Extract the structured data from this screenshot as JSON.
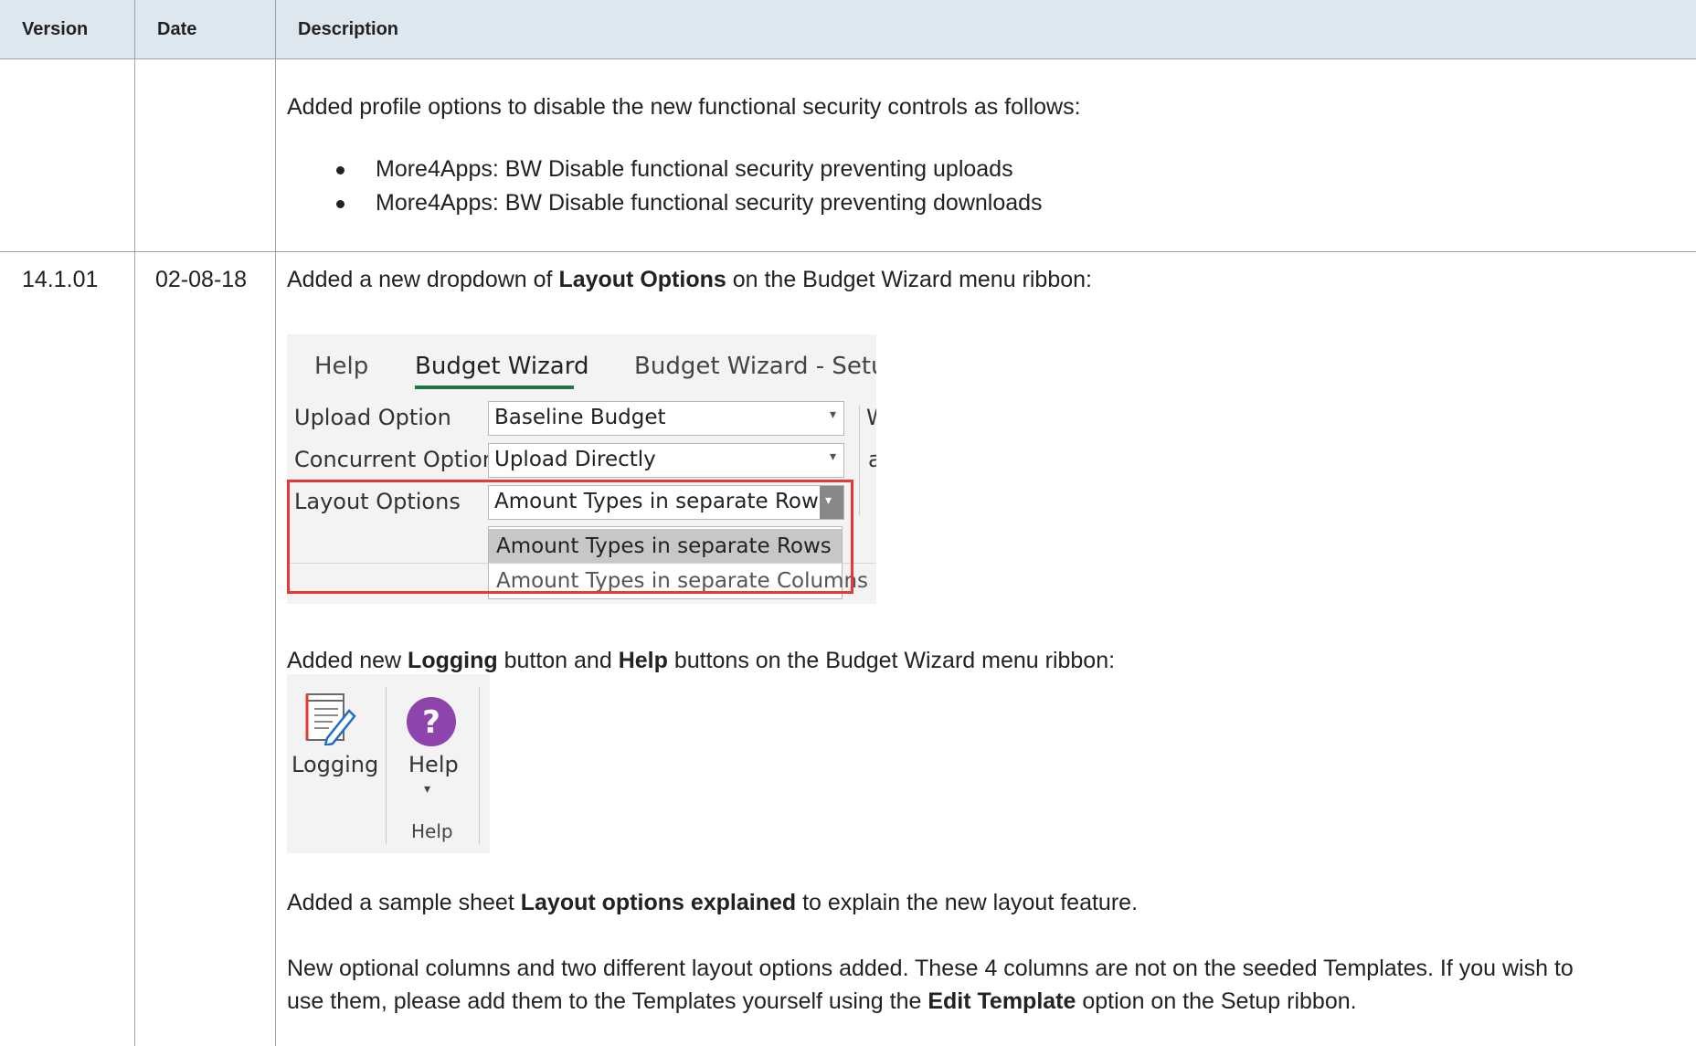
{
  "header": {
    "version": "Version",
    "date": "Date",
    "description": "Description"
  },
  "row1": {
    "intro": "Added profile options to disable the new functional security controls as follows:",
    "bullets": [
      "More4Apps: BW Disable functional security preventing uploads",
      "More4Apps: BW Disable functional security preventing downloads"
    ]
  },
  "row2": {
    "version": "14.1.01",
    "date": "02-08-18",
    "p1_pre": "Added a new dropdown of ",
    "p1_bold": "Layout Options",
    "p1_post": " on the Budget Wizard menu ribbon:",
    "ribbon": {
      "tabs": [
        "Help",
        "Budget Wizard",
        "Budget Wizard - Setup"
      ],
      "upload_label": "Upload Option",
      "upload_value": "Baseline Budget",
      "concurrent_label": "Concurrent Option",
      "concurrent_value": "Upload Directly",
      "layout_label": "Layout Options",
      "layout_value": "Amount Types in separate Rows",
      "layout_options": [
        "Amount Types in separate Rows",
        "Amount Types in separate Columns"
      ]
    },
    "p2_a": "Added new ",
    "p2_b": "Logging",
    "p2_c": " button and ",
    "p2_d": "Help",
    "p2_e": " buttons on the Budget Wizard menu ribbon:",
    "ribbon2": {
      "logging_label": "Logging",
      "help_label": "Help",
      "group_label": "Help"
    },
    "p3_pre": "Added a sample sheet ",
    "p3_bold": "Layout options explained",
    "p3_post": " to explain the new layout feature.",
    "p4_line1": "New optional columns and two different layout options added. These 4 columns are not on the seeded Templates. If you wish to",
    "p4_line2_pre": "use them, please add them to the Templates yourself using the ",
    "p4_line2_bold": "Edit Template",
    "p4_line2_post": " option on the Setup ribbon."
  },
  "colors": {
    "header_bg": "#dde7f0",
    "grid": "#9aa5ad",
    "highlight": "#e53935",
    "tab_accent": "#217346",
    "help_icon": "#8e44ad"
  }
}
